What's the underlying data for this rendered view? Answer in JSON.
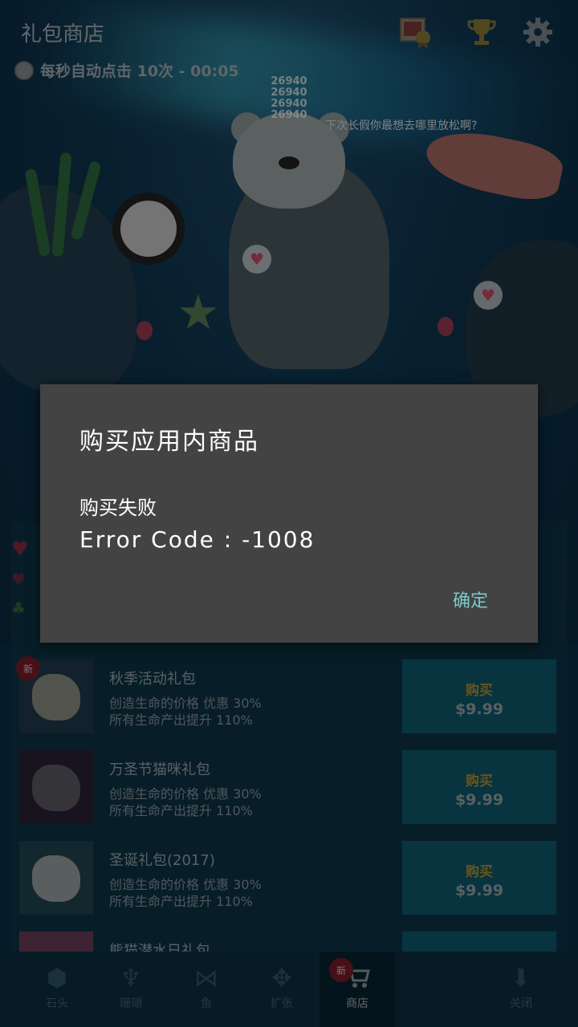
{
  "top_bar": {
    "title": "礼包商店",
    "auto_click_text": "每秒自动点击 10次 - 00:05",
    "icons": [
      "photo-award-icon",
      "trophy-icon",
      "gear-icon"
    ]
  },
  "scene": {
    "counters": [
      "26940",
      "26940",
      "26940",
      "26940"
    ],
    "speech_text": "下次长假你最想去哪里放松啊?"
  },
  "shop": {
    "items": [
      {
        "name": "秋季活动礼包",
        "new_badge": "新",
        "desc_line1": "创造生命的价格 优惠 30%",
        "desc_line2": "所有生命产出提升 110%",
        "buy_label": "购买",
        "price": "$9.99",
        "thumb_color": "#1f3a4a"
      },
      {
        "name": "万圣节猫咪礼包",
        "desc_line1": "创造生命的价格 优惠 30%",
        "desc_line2": "所有生命产出提升 110%",
        "buy_label": "购买",
        "price": "$9.99",
        "thumb_color": "#2a2236"
      },
      {
        "name": "圣诞礼包(2017)",
        "desc_line1": "创造生命的价格 优惠 30%",
        "desc_line2": "所有生命产出提升 110%",
        "buy_label": "购买",
        "price": "$9.99",
        "thumb_color": "#1f4450"
      },
      {
        "name": "熊猫潜水日礼包",
        "buy_label": "",
        "price": ""
      }
    ]
  },
  "bottom_nav": {
    "items": [
      {
        "label": "石头",
        "icon": "stone-icon"
      },
      {
        "label": "珊瑚",
        "icon": "coral-icon"
      },
      {
        "label": "鱼",
        "icon": "fish-icon"
      },
      {
        "label": "扩张",
        "icon": "expand-icon"
      },
      {
        "label": "商店",
        "icon": "cart-icon",
        "badge": "新",
        "active": true
      },
      {
        "label": "关闭",
        "icon": "close-download-icon"
      }
    ]
  },
  "dialog": {
    "title": "购买应用内商品",
    "message_line1": "购买失败",
    "message_line2": "Error Code : -1008",
    "ok_label": "确定"
  },
  "colors": {
    "dialog_bg": "#434343",
    "dialog_accent": "#7cc9c7",
    "buy_button": "#0e5a6e",
    "new_badge": "#7a1d26"
  }
}
